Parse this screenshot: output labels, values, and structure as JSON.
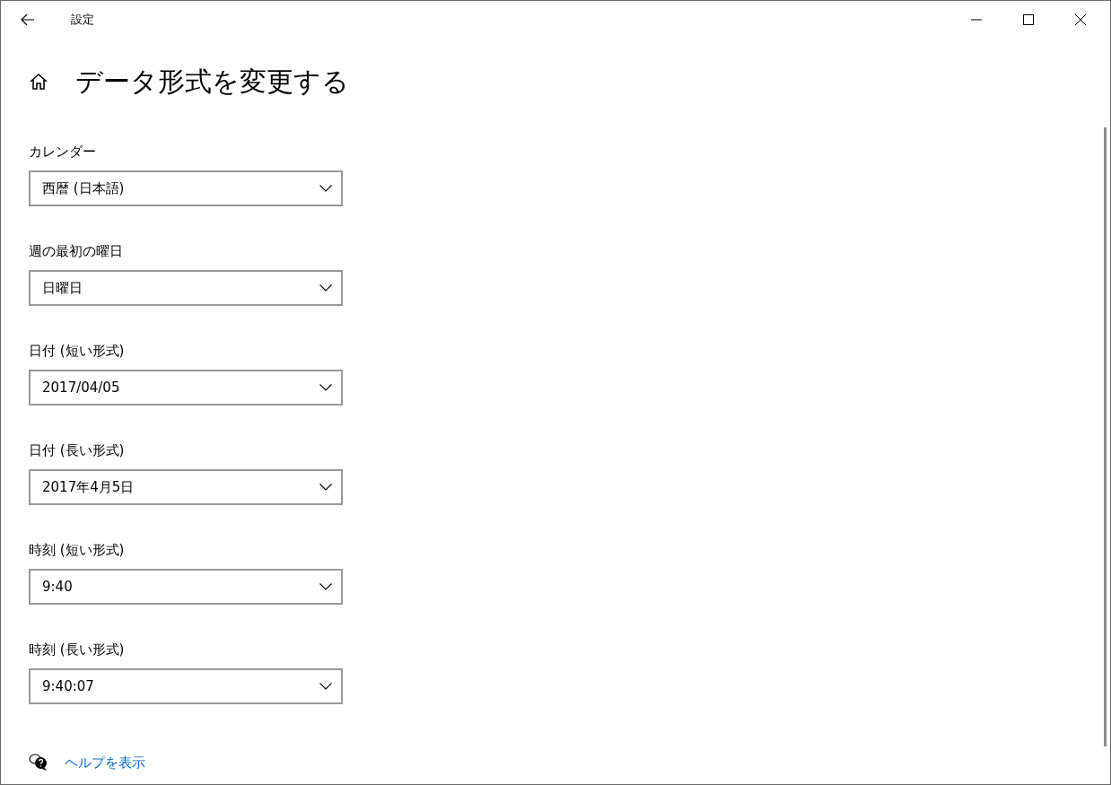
{
  "window": {
    "title": "設定"
  },
  "page": {
    "title": "データ形式を変更する"
  },
  "settings": [
    {
      "label": "カレンダー",
      "value": "西暦 (日本語)"
    },
    {
      "label": "週の最初の曜日",
      "value": "日曜日"
    },
    {
      "label": "日付 (短い形式)",
      "value": "2017/04/05"
    },
    {
      "label": "日付 (長い形式)",
      "value": "2017年4月5日"
    },
    {
      "label": "時刻 (短い形式)",
      "value": "9:40"
    },
    {
      "label": "時刻 (長い形式)",
      "value": "9:40:07"
    }
  ],
  "help_link": "ヘルプを表示"
}
